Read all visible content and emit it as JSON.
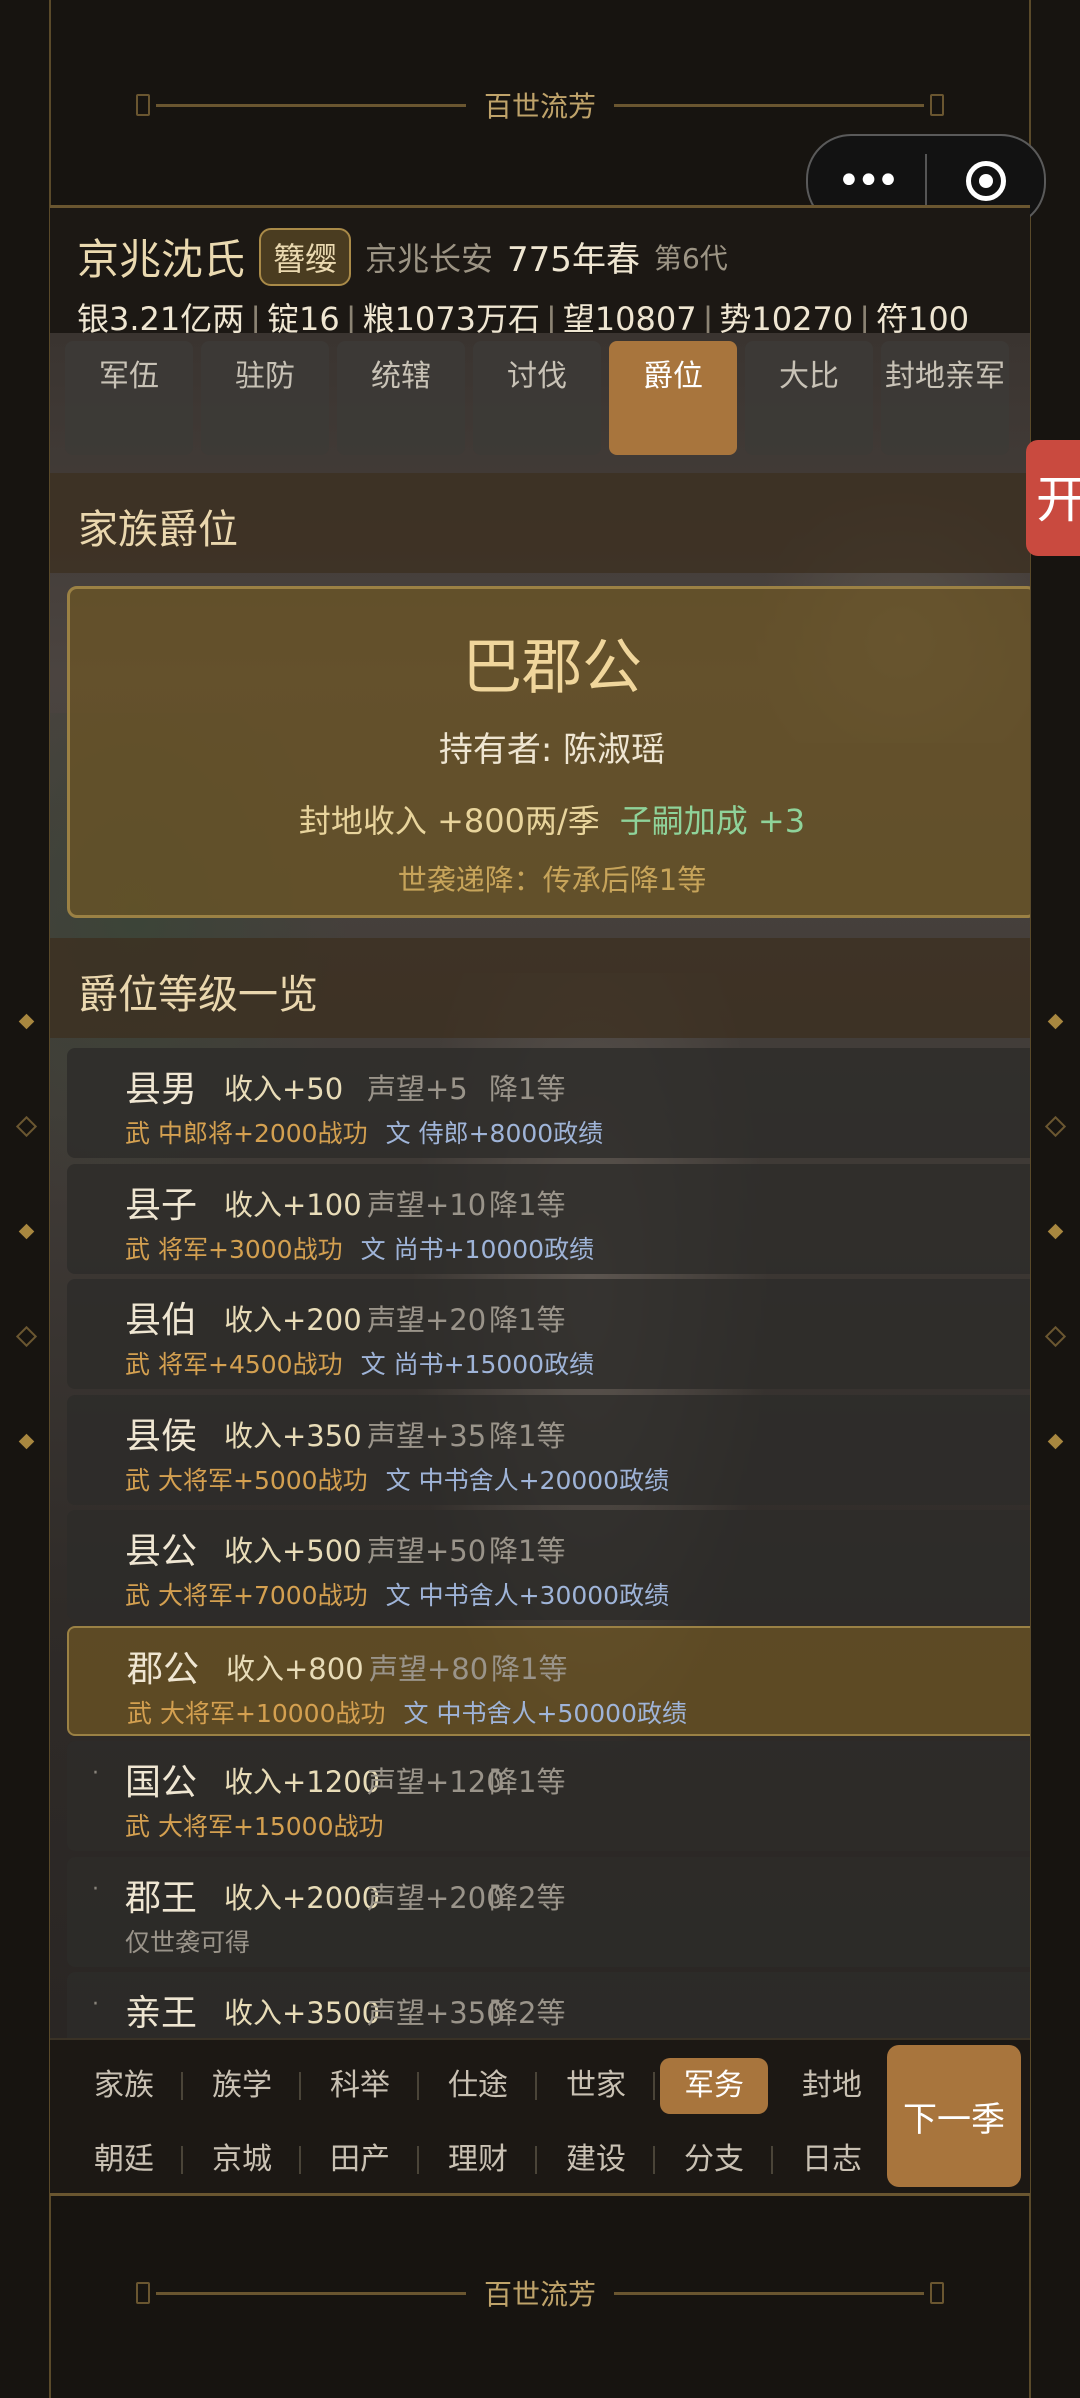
{
  "banner_text": "百世流芳",
  "capsule": {
    "more_icon": "more-dots-icon",
    "close_icon": "target-close-icon"
  },
  "header": {
    "clan": "京兆沈氏",
    "badge": "簪缨",
    "location": "京兆长安",
    "year": "775年春",
    "generation": "第6代",
    "resources": [
      "银3.21亿两",
      "锭16",
      "粮1073万石",
      "望10807",
      "势10270",
      "符100"
    ]
  },
  "tabs": [
    {
      "label": "军伍",
      "active": false
    },
    {
      "label": "驻防",
      "active": false
    },
    {
      "label": "统辖",
      "active": false
    },
    {
      "label": "讨伐",
      "active": false
    },
    {
      "label": "爵位",
      "active": true
    },
    {
      "label": "大比",
      "active": false
    },
    {
      "label": "封地亲军",
      "active": false
    }
  ],
  "family_title": {
    "section": "家族爵位",
    "title": "巴郡公",
    "holder": "持有者: 陈淑瑶",
    "income": "封地收入 +800两/季",
    "bonus": "子嗣加成 +3",
    "decline": "世袭递降：传承后降1等"
  },
  "ranks_section": "爵位等级一览",
  "ranks": [
    {
      "name": "县男",
      "income": "收入+50",
      "rep": "声望+5",
      "decline": "降1等",
      "wu": "武",
      "wu_req": "中郎将+2000战功",
      "wen": "文",
      "wen_req": "侍郎+8000政绩",
      "only": "",
      "bullet": "",
      "current": false
    },
    {
      "name": "县子",
      "income": "收入+100",
      "rep": "声望+10",
      "decline": "降1等",
      "wu": "武",
      "wu_req": "将军+3000战功",
      "wen": "文",
      "wen_req": "尚书+10000政绩",
      "only": "",
      "bullet": "",
      "current": false
    },
    {
      "name": "县伯",
      "income": "收入+200",
      "rep": "声望+20",
      "decline": "降1等",
      "wu": "武",
      "wu_req": "将军+4500战功",
      "wen": "文",
      "wen_req": "尚书+15000政绩",
      "only": "",
      "bullet": "",
      "current": false
    },
    {
      "name": "县侯",
      "income": "收入+350",
      "rep": "声望+35",
      "decline": "降1等",
      "wu": "武",
      "wu_req": "大将军+5000战功",
      "wen": "文",
      "wen_req": "中书舍人+20000政绩",
      "only": "",
      "bullet": "",
      "current": false
    },
    {
      "name": "县公",
      "income": "收入+500",
      "rep": "声望+50",
      "decline": "降1等",
      "wu": "武",
      "wu_req": "大将军+7000战功",
      "wen": "文",
      "wen_req": "中书舍人+30000政绩",
      "only": "",
      "bullet": "",
      "current": false
    },
    {
      "name": "郡公",
      "income": "收入+800",
      "rep": "声望+80",
      "decline": "降1等",
      "wu": "武",
      "wu_req": "大将军+10000战功",
      "wen": "文",
      "wen_req": "中书舍人+50000政绩",
      "only": "",
      "bullet": "",
      "current": true
    },
    {
      "name": "国公",
      "income": "收入+1200",
      "rep": "声望+120",
      "decline": "降1等",
      "wu": "武",
      "wu_req": "大将军+15000战功",
      "wen": "",
      "wen_req": "",
      "only": "",
      "bullet": "·",
      "current": false
    },
    {
      "name": "郡王",
      "income": "收入+2000",
      "rep": "声望+200",
      "decline": "降2等",
      "wu": "",
      "wu_req": "",
      "wen": "",
      "wen_req": "",
      "only": "仅世袭可得",
      "bullet": "·",
      "current": false
    },
    {
      "name": "亲王",
      "income": "收入+3500",
      "rep": "声望+350",
      "decline": "降2等",
      "wu": "",
      "wu_req": "",
      "wen": "",
      "wen_req": "",
      "only": "",
      "bullet": "·",
      "current": false
    }
  ],
  "nav_row1": [
    {
      "label": "家族",
      "active": false
    },
    {
      "label": "族学",
      "active": false
    },
    {
      "label": "科举",
      "active": false
    },
    {
      "label": "仕途",
      "active": false
    },
    {
      "label": "世家",
      "active": false
    },
    {
      "label": "军务",
      "active": true
    },
    {
      "label": "封地",
      "active": false
    }
  ],
  "nav_row2": [
    {
      "label": "朝廷",
      "active": false
    },
    {
      "label": "京城",
      "active": false
    },
    {
      "label": "田产",
      "active": false
    },
    {
      "label": "理财",
      "active": false
    },
    {
      "label": "建设",
      "active": false
    },
    {
      "label": "分支",
      "active": false
    },
    {
      "label": "日志",
      "active": false
    }
  ],
  "next_season": "下一季",
  "side_tab": "开"
}
